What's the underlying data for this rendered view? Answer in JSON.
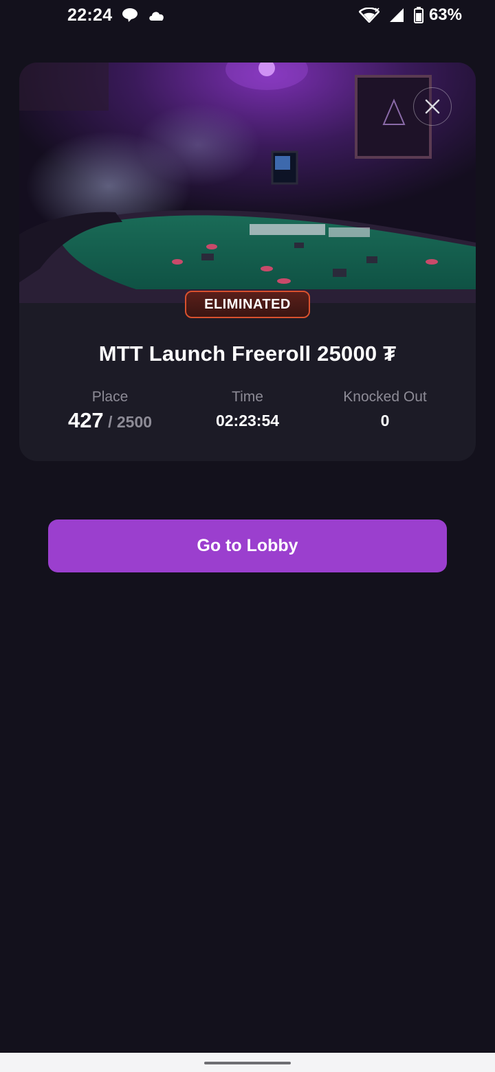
{
  "status_bar": {
    "time": "22:24",
    "battery": "63%",
    "icons": [
      "chat-icon",
      "cloud-icon",
      "wifi-icon",
      "signal-icon",
      "battery-icon"
    ]
  },
  "card": {
    "badge": "ELIMINATED",
    "title": "MTT Launch Freeroll 25000 ₮",
    "stats": {
      "place_label": "Place",
      "place_value": "427",
      "place_total": "/ 2500",
      "time_label": "Time",
      "time_value": "02:23:54",
      "knocked_label": "Knocked Out",
      "knocked_value": "0"
    },
    "close_icon": "close-icon"
  },
  "lobby_button": "Go to Lobby",
  "colors": {
    "background": "#13111c",
    "card": "#1c1b26",
    "accent": "#9b3fce",
    "badge_border": "#d9512e",
    "muted_text": "#8d8b96"
  }
}
